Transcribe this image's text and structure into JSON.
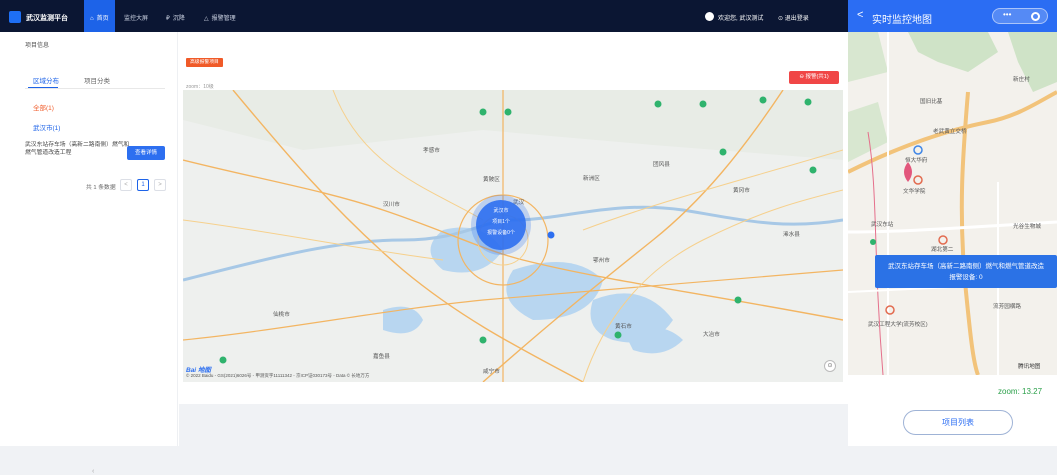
{
  "topbar": {
    "brand": "武汉监测平台",
    "nav": [
      {
        "icon": "⌂",
        "label": "首页"
      },
      {
        "icon": "",
        "label": "监控大屏"
      },
      {
        "icon": "₽",
        "label": "沉降"
      },
      {
        "icon": "△",
        "label": "报警管理"
      }
    ],
    "user": "欢迎您, 武汉测试",
    "logout": "⊙ 退出登录"
  },
  "sidebar": {
    "title": "项目信息",
    "tabs": [
      "区域分布",
      "项目分类"
    ],
    "regions": [
      "全部(1)",
      "武汉市(1)"
    ],
    "project_name": "武汉东站存车场（高新二路南侧）燃气和燃气管道改造工程",
    "detail_button": "查看详情",
    "total": "共 1 条数据",
    "pagination": {
      "prev": "<",
      "current": "1",
      "next": ">"
    },
    "collapse_icon": "‹"
  },
  "main": {
    "tag": "高级报警项目",
    "alarm_button": "⊖ 报警(共1)",
    "breadcrumb": "zoom：10级",
    "cluster": {
      "city": "武汉市",
      "projects": "项目1个",
      "alarm_devices": "报警设备0个"
    },
    "map_labels": [
      "孝感市",
      "黄冈市",
      "鄂州市",
      "黄石市",
      "咸宁市",
      "武汉",
      "新洲区",
      "黄陂区",
      "汉川市",
      "仙桃市",
      "嘉鱼县",
      "大冶市",
      "团风县",
      "浠水县"
    ],
    "baidu": "Bai 地图",
    "copyright": "© 2022 Baidu - GS(2021)6026号 - 甲测资字11111342 - 京ICP证030173号 - Data © 长地万方",
    "zoom_control": "⊙"
  },
  "panel": {
    "title": "实时监控地图",
    "back": "<",
    "capsule_dots": "•••",
    "map_labels": [
      "新庄村",
      "国旧比基",
      "老武黄立交桥",
      "恒大华府",
      "文华学院",
      "武汉东站",
      "光谷生物城",
      "湖北第二",
      "流芳园横路",
      "武汉工程大学(流芳校区)",
      "腾讯地图"
    ],
    "popup_line1": "武汉东站存车场（高新二路南侧）燃气和燃气管道改造",
    "popup_line2": "报警设备: 0",
    "zoom": "zoom: 13.27",
    "list_button": "项目列表"
  },
  "colors": {
    "topbar": "#0b1633",
    "accent": "#1d63e8",
    "alarm": "#f04646",
    "panel_head": "#2b6df3"
  }
}
